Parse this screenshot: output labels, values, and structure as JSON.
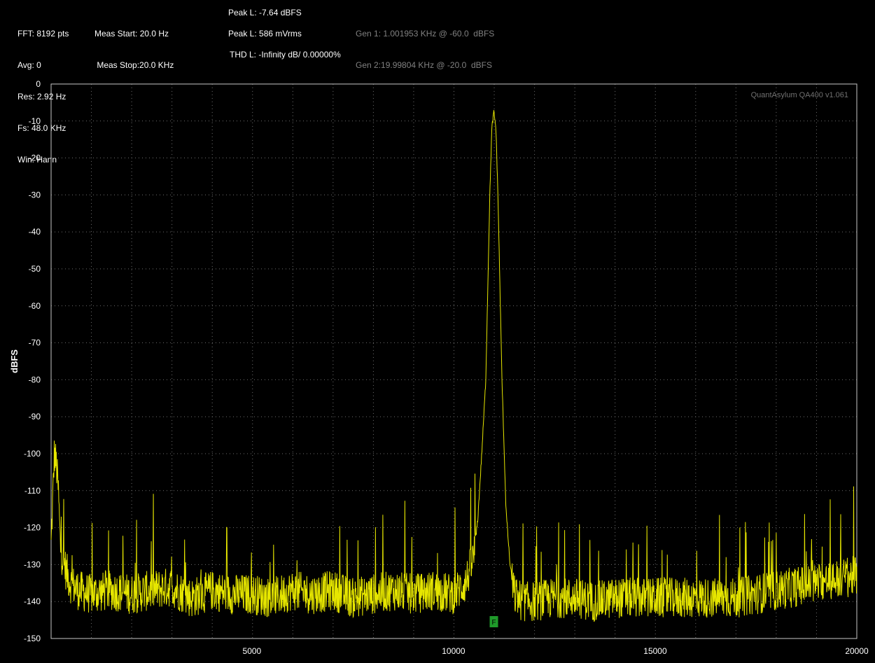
{
  "info": {
    "col1": [
      "FFT: 8192 pts",
      "Avg: 0",
      "Res: 2.92 Hz",
      "Fs: 48.0 KHz",
      "Win: Hann"
    ],
    "col2": [
      "Meas Start: 20.0 Hz",
      " Meas Stop:20.0 KHz"
    ],
    "peak_l_dbfs": "Peak L: -7.64 dBFS",
    "peak_l_vrms": "Peak L: 586 mVrms",
    "thd_l": "THD L: -Infinity dB/ 0.00000%",
    "gen1": "Gen 1: 1.001953 KHz @ -60.0  dBFS",
    "gen2": "Gen 2:19.99804 KHz @ -20.0  dBFS"
  },
  "watermark": "QuantAsylum QA400 v1.061",
  "marker_label": "F",
  "colors": {
    "background": "#000000",
    "trace": "#e6e600",
    "grid": "#6e6e6e",
    "frame": "#c8c8c8",
    "marker": "#1f9a2a",
    "info_text": "#ffffff",
    "gen_text": "#808080"
  },
  "chart_data": {
    "type": "line",
    "title": "",
    "xlabel": "",
    "ylabel": "dBFS",
    "xlim": [
      20,
      20000
    ],
    "ylim": [
      -150,
      0
    ],
    "x_ticks": [
      5000,
      10000,
      15000,
      20000
    ],
    "y_ticks": [
      0,
      -10,
      -20,
      -30,
      -40,
      -50,
      -60,
      -70,
      -80,
      -90,
      -100,
      -110,
      -120,
      -130,
      -140,
      -150
    ],
    "grid": true,
    "series": [
      {
        "values_note": "",
        "x": [
          20,
          100,
          150,
          200,
          250,
          300,
          400,
          500,
          700,
          1000,
          1500,
          2000,
          2500,
          3000,
          3500,
          4000,
          4500,
          5000,
          5500,
          6000,
          6500,
          7000,
          7500,
          8000,
          8500,
          9000,
          9500,
          10000,
          10300,
          10500,
          10600,
          10700,
          10800,
          10850,
          10900,
          10950,
          11000,
          11050,
          11100,
          11150,
          11200,
          11300,
          11400,
          11500,
          11700,
          12000,
          12500,
          13000,
          13500,
          14000,
          14500,
          15000,
          15500,
          16000,
          16500,
          17000,
          17500,
          18000,
          18500,
          19000,
          19500,
          20000
        ],
        "y": [
          -125,
          -100,
          -103,
          -110,
          -125,
          -128,
          -132,
          -135,
          -137,
          -138,
          -137,
          -138,
          -137,
          -136,
          -139,
          -137,
          -138,
          -138,
          -139,
          -137,
          -138,
          -137,
          -139,
          -138,
          -137,
          -138,
          -137,
          -138,
          -135,
          -128,
          -118,
          -100,
          -80,
          -55,
          -30,
          -12,
          -7.64,
          -12,
          -30,
          -55,
          -80,
          -115,
          -130,
          -138,
          -140,
          -140,
          -139,
          -139,
          -140,
          -139,
          -139,
          -139,
          -139,
          -139,
          -139,
          -139,
          -138,
          -137,
          -136,
          -135,
          -134,
          -133
        ]
      }
    ],
    "annotations": [
      "F"
    ]
  }
}
